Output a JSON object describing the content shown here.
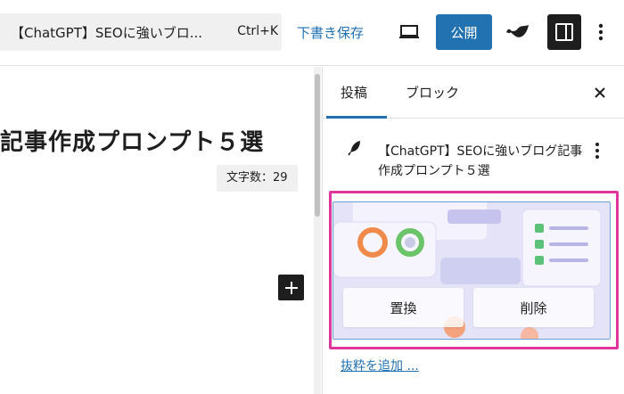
{
  "toolbar": {
    "document_title": "【ChatGPT】SEOに強いブロ...",
    "shortcut": "Ctrl+K",
    "save_draft": "下書き保存",
    "publish": "公開"
  },
  "editor": {
    "post_title": "記事作成プロンプト５選",
    "char_count": "文字数：29"
  },
  "sidebar": {
    "tabs": [
      "投稿",
      "ブロック"
    ],
    "post_title": "【ChatGPT】SEOに強いブログ記事作成プロンプト５選",
    "featured_image": {
      "replace": "置換",
      "delete": "削除"
    },
    "add_excerpt": "抜粋を追加 ..."
  },
  "colors": {
    "accent": "#2271b1",
    "highlight": "#e0359a",
    "dark": "#1e1e1e"
  }
}
